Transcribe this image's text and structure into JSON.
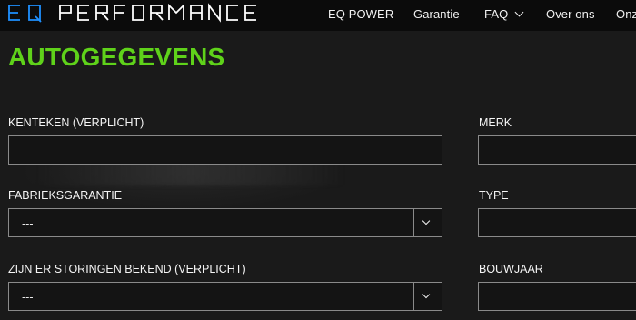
{
  "header": {
    "logo_text": "EQ PERFORMANCE",
    "nav": [
      {
        "label": "EQ POWER"
      },
      {
        "label": "Garantie"
      },
      {
        "label": "FAQ"
      },
      {
        "label": "Over ons"
      },
      {
        "label": "Onz"
      }
    ],
    "logo_colors": {
      "eq": "#1e90ff",
      "performance": "#ffffff"
    }
  },
  "form": {
    "title": "AUTOGEGEVENS",
    "fields": {
      "kenteken": {
        "label": "KENTEKEN (VERPLICHT)",
        "value": ""
      },
      "merk": {
        "label": "MERK",
        "value": ""
      },
      "fabrieksgarantie": {
        "label": "FABRIEKSGARANTIE",
        "value": "---"
      },
      "type": {
        "label": "TYPE",
        "value": ""
      },
      "storingen": {
        "label": "ZIJN ER STORINGEN BEKEND (VERPLICHT)",
        "value": "---"
      },
      "bouwjaar": {
        "label": "BOUWJAAR",
        "value": ""
      }
    }
  },
  "colors": {
    "accent": "#5fd21a",
    "background": "#1a1a1a",
    "topbar": "#0b0b0b"
  },
  "icons": [
    "chevron-down-icon"
  ]
}
